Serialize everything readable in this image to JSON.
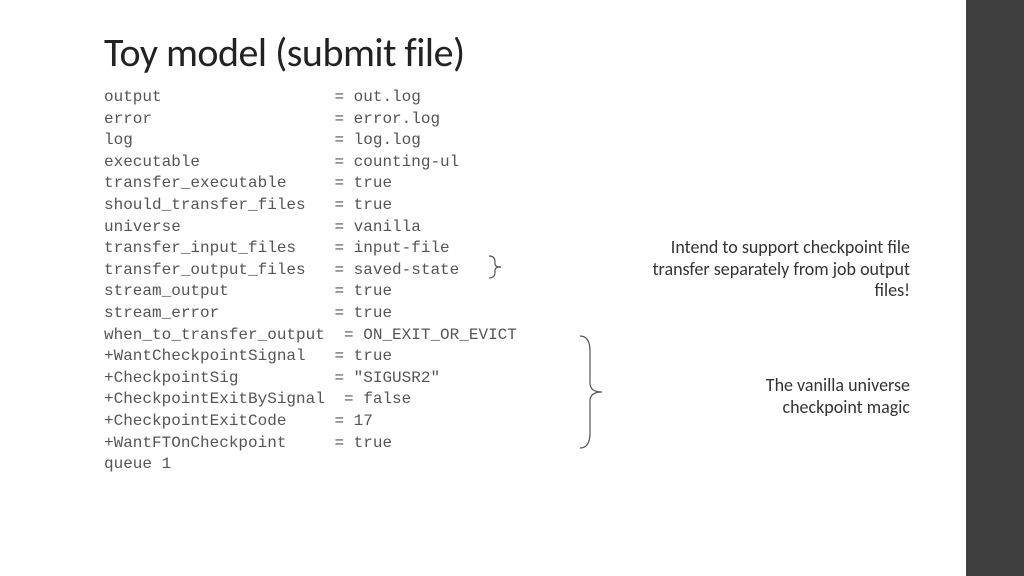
{
  "title": "Toy model (submit file)",
  "lines": [
    {
      "key": "output",
      "value": "out.log"
    },
    {
      "key": "error",
      "value": "error.log"
    },
    {
      "key": "log",
      "value": "log.log"
    },
    {
      "key": "executable",
      "value": "counting-ul"
    },
    {
      "key": "transfer_executable",
      "value": "true"
    },
    {
      "key": "should_transfer_files",
      "value": "true"
    },
    {
      "key": "universe",
      "value": "vanilla"
    },
    {
      "key": "transfer_input_files",
      "value": "input-file"
    },
    {
      "key": "transfer_output_files",
      "value": "saved-state"
    },
    {
      "key": "stream_output",
      "value": "true"
    },
    {
      "key": "stream_error",
      "value": "true"
    },
    {
      "key": "when_to_transfer_output",
      "value": "ON_EXIT_OR_EVICT"
    },
    {
      "key": "+WantCheckpointSignal",
      "value": "true"
    },
    {
      "key": "+CheckpointSig",
      "value": "\"SIGUSR2\""
    },
    {
      "key": "+CheckpointExitBySignal",
      "value": "false"
    },
    {
      "key": "+CheckpointExitCode",
      "value": "17"
    },
    {
      "key": "+WantFTOnCheckpoint",
      "value": "true"
    }
  ],
  "final_line": "queue 1",
  "annotations": {
    "top": "Intend to support checkpoint file transfer separately from job output files!",
    "bottom": "The vanilla universe checkpoint magic"
  }
}
